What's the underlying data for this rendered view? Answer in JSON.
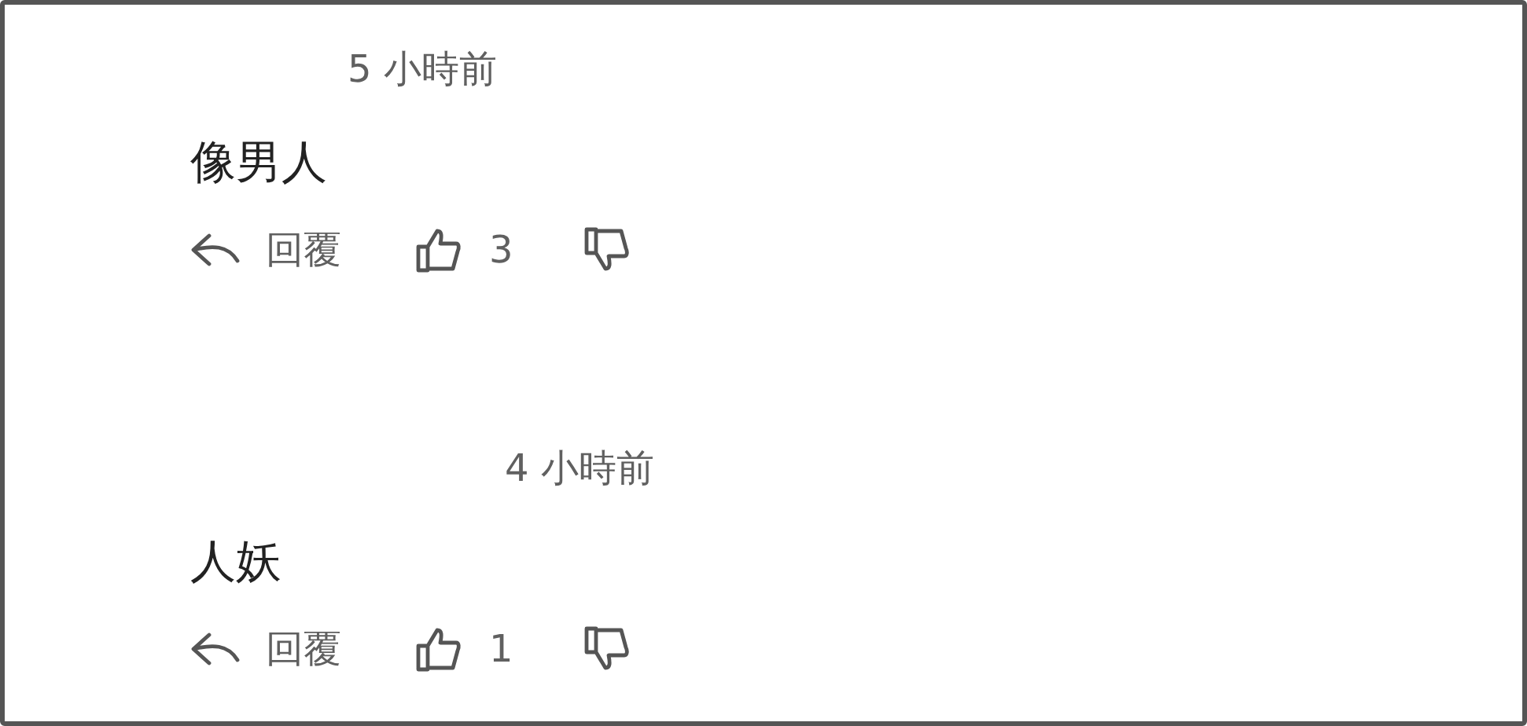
{
  "comments": [
    {
      "time": "5 小時前",
      "text": "像男人",
      "reply_label": "回覆",
      "likes": "3"
    },
    {
      "time": "4 小時前",
      "text": "人妖",
      "reply_label": "回覆",
      "likes": "1"
    }
  ]
}
